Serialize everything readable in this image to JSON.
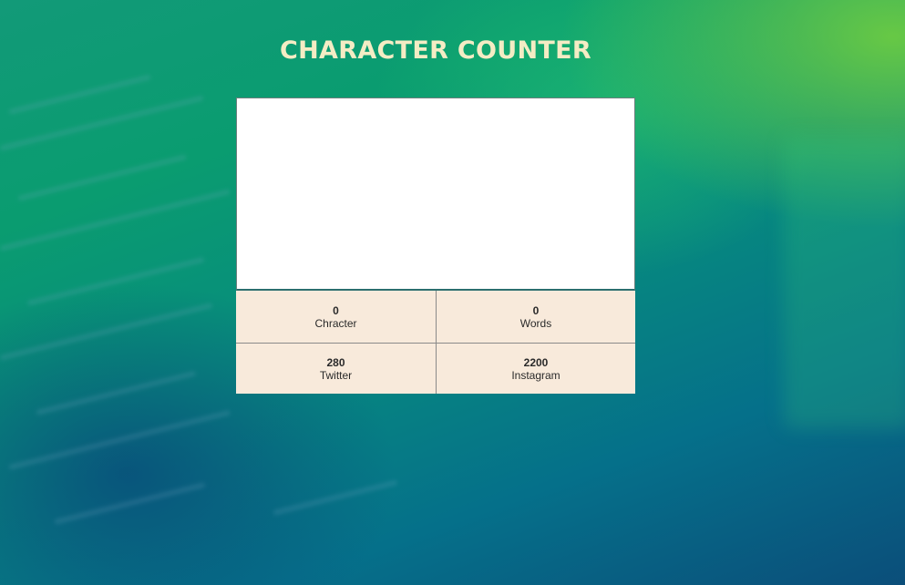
{
  "header": {
    "title": "CHARACTER COUNTER"
  },
  "editor": {
    "value": "",
    "placeholder": ""
  },
  "stats": {
    "characters": {
      "value": "0",
      "label": "Chracter"
    },
    "words": {
      "value": "0",
      "label": "Words"
    },
    "twitter": {
      "value": "280",
      "label": "Twitter"
    },
    "instagram": {
      "value": "2200",
      "label": "Instagram"
    }
  },
  "colors": {
    "title": "#f4ecc4",
    "stats_background": "#f8eadb",
    "background_top": "#0a9c70",
    "background_bottom": "#0b4e7a"
  }
}
